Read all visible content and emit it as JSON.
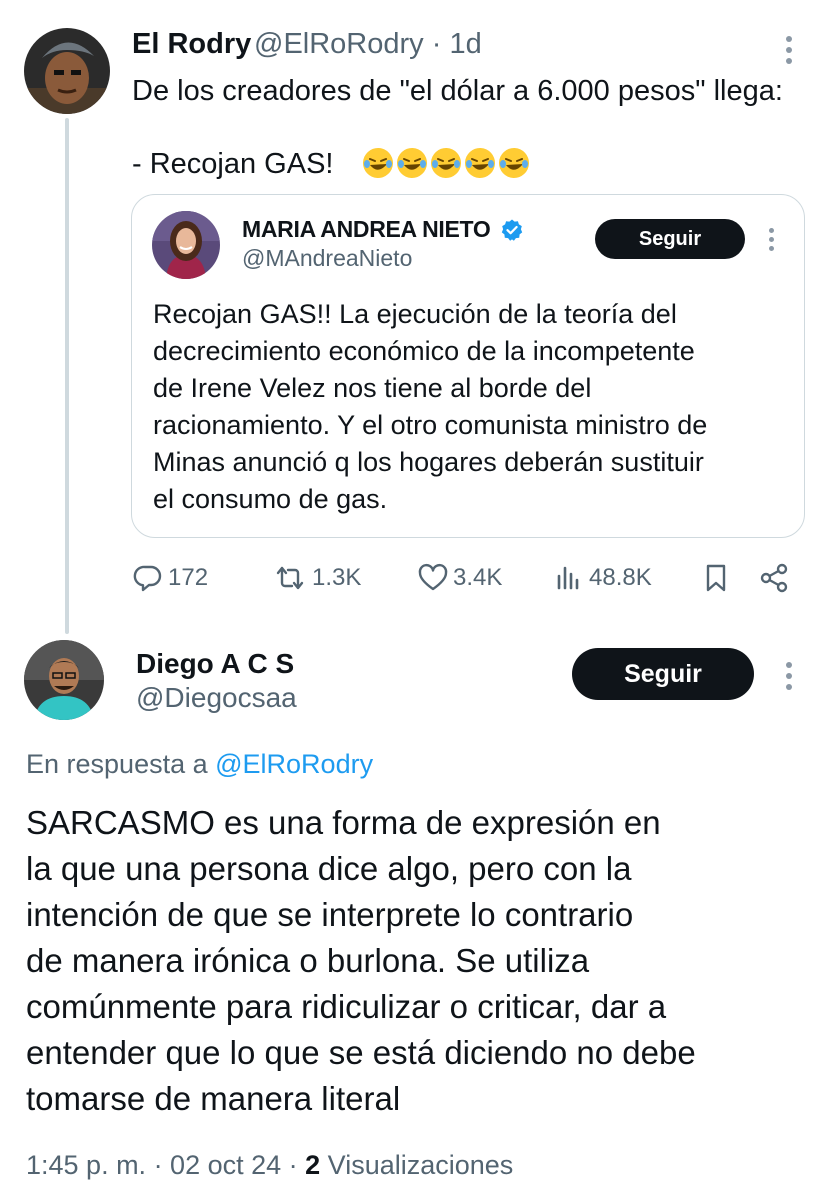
{
  "parent_tweet": {
    "author_name": "El Rodry",
    "handle": "@ElRoRodry",
    "time": "1d",
    "text_line1": "De los creadores de \"el dólar a 6.000 pesos\" llega:",
    "text_line2": "- Recojan GAS!",
    "emoji_count": 5,
    "quoted": {
      "author_name": "MARIA ANDREA NIETO",
      "handle": "@MAndreaNieto",
      "follow_label": "Seguir",
      "lines": [
        "Recojan GAS!! La ejecución de la teoría del",
        "decrecimiento económico de la incompetente",
        "de Irene Velez nos tiene al borde del",
        "racionamiento. Y el otro comunista ministro de",
        "Minas anunció q los hogares deberán sustituir",
        "el consumo de gas."
      ]
    },
    "stats": {
      "replies": "172",
      "reposts": "1.3K",
      "likes": "3.4K",
      "views": "48.8K"
    }
  },
  "reply_tweet": {
    "author_name": "Diego A C S",
    "handle": "@Diegocsaa",
    "follow_label": "Seguir",
    "in_reply_prefix": "En respuesta a ",
    "in_reply_handle": "@ElRoRodry",
    "lines": [
      "SARCASMO es una forma de expresión en",
      "la que una persona dice algo, pero con la",
      "intención de que se interprete lo contrario",
      "de manera irónica o burlona. Se utiliza",
      "comúnmente para ridiculizar o criticar, dar a",
      "entender que lo que se está diciendo no debe",
      "tomarse de manera literal"
    ],
    "meta_time": "1:45 p. m. · 02 oct 24 · ",
    "meta_views_count": "2",
    "meta_views_label": " Visualizaciones"
  },
  "colors": {
    "text": "#0f1419",
    "secondary": "#536471",
    "link": "#1d9bf0",
    "border": "#cfd9de",
    "button_bg": "#0f1419"
  },
  "icons": [
    "more-icon",
    "laughing-emoji-icon",
    "verified-badge-icon",
    "reply-icon",
    "repost-icon",
    "like-icon",
    "views-icon",
    "bookmark-icon",
    "share-icon"
  ]
}
